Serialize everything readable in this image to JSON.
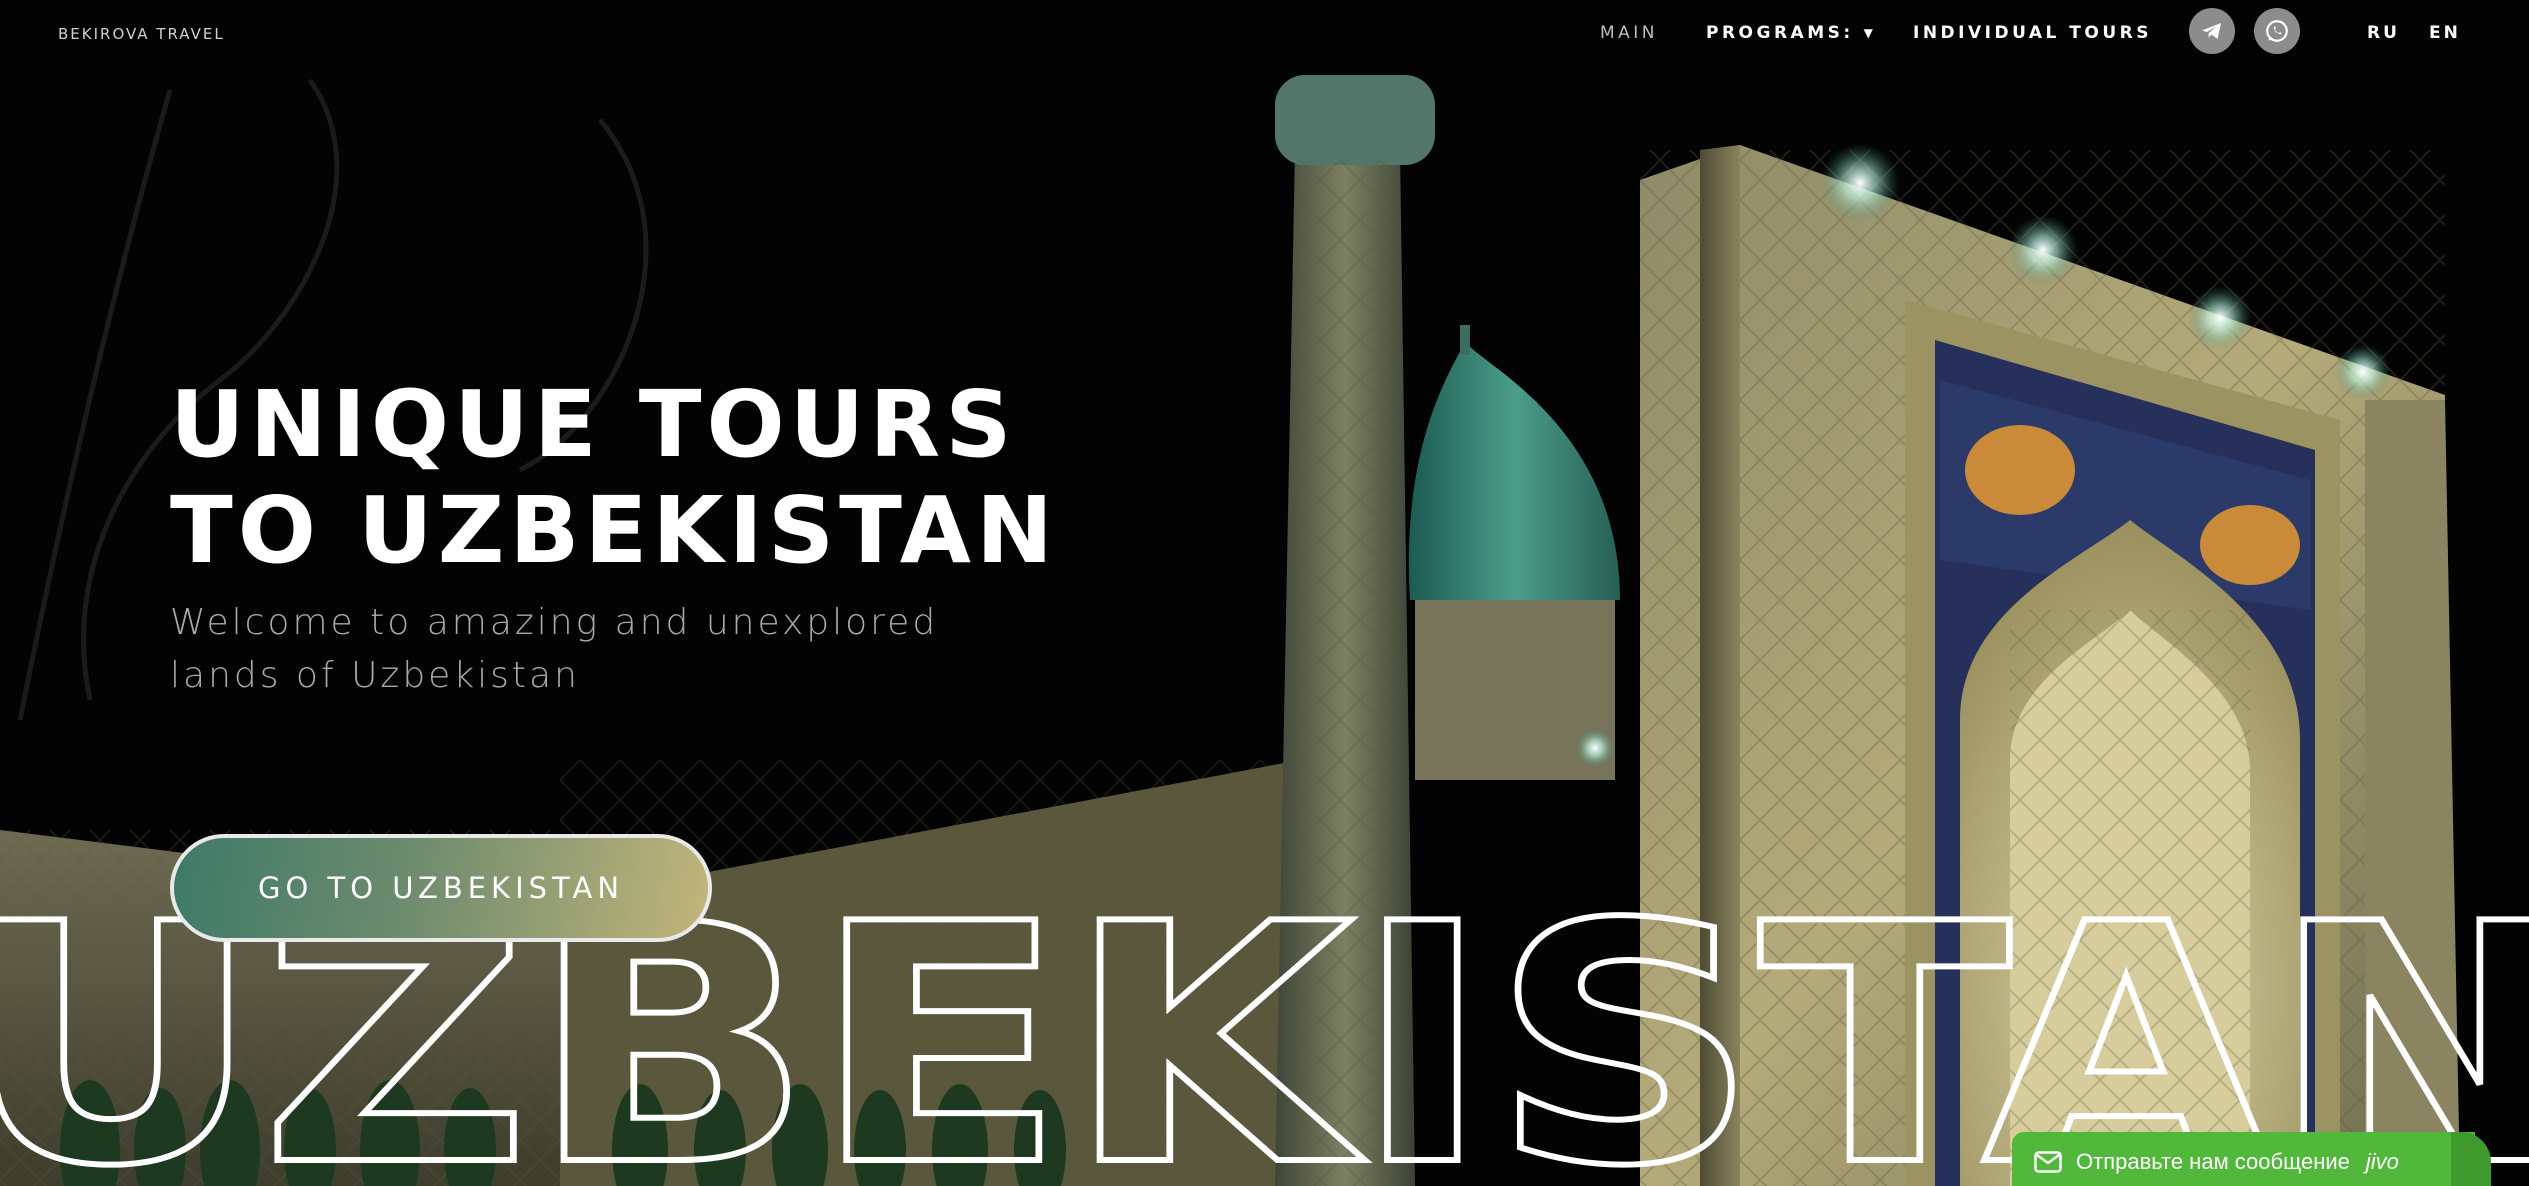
{
  "header": {
    "brand": "BEKIROVA TRAVEL",
    "nav": {
      "main": "MAIN",
      "programs": "PROGRAMS:",
      "individual": "INDIVIDUAL TOURS"
    },
    "social": [
      {
        "name": "telegram-icon"
      },
      {
        "name": "whatsapp-icon"
      }
    ],
    "languages": [
      "RU",
      "EN"
    ]
  },
  "hero": {
    "title_line1": "UNIQUE TOURS",
    "title_line2": "TO UZBEKISTAN",
    "subtitle_line1": "Welcome to amazing and unexplored",
    "subtitle_line2": "lands of Uzbekistan",
    "cta": "GO TO UZBEKISTAN",
    "outline_word": "UZBEKISTAN"
  },
  "chat_widget": {
    "label": "Отправьте нам сообщение",
    "brand": "jivo",
    "icon": "mail-icon"
  },
  "colors": {
    "chat_green": "#52b83b",
    "cta_start": "#3d7a68",
    "cta_end": "#c2b57a"
  }
}
